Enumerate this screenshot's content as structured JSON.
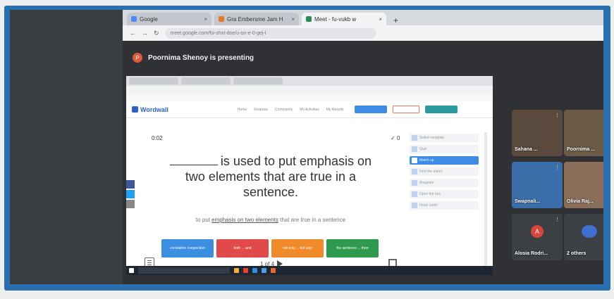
{
  "browser": {
    "tabs": [
      {
        "label": "Google",
        "color": "#4a8af4"
      },
      {
        "label": "Gra Embersme Jam H",
        "color": "#e8792a"
      },
      {
        "label": "Meet - fu-vukb w",
        "color": "#2d8a5a"
      }
    ],
    "url": "meet.google.com/fsi-shxt-doe/u-on-e-0-gej-l"
  },
  "meet": {
    "presenter_initial": "P",
    "presenting_text": "Poornima Shenoy is presenting",
    "participants": [
      {
        "name": "Sahana ...",
        "tile_color": "#5a4a3e"
      },
      {
        "name": "Poornima ...",
        "tile_color": "#6b5a45"
      },
      {
        "name": "Swapnali...",
        "tile_color": "#3a6ea8"
      },
      {
        "name": "Olivia Raj...",
        "tile_color": "#8a6e5a"
      },
      {
        "name": "Alosia Rodri...",
        "initial": "A",
        "avatar_color": "#d9453a"
      },
      {
        "name": "2 others"
      }
    ]
  },
  "wordwall": {
    "logo": "Wordwall",
    "nav": [
      "Home",
      "Features",
      "Community",
      "My Activities",
      "My Results"
    ],
    "timer": "0:02",
    "score": "0",
    "question_rest": "is used to put emphasis on two elements that are true in a sentence.",
    "hint_pre": "to put ",
    "hint_link": "emphasis on two elements",
    "hint_post": " that are true in a sentence",
    "answers": [
      {
        "label": "correlative conjunction",
        "color": "#3b8fe0"
      },
      {
        "label": "both ... and",
        "color": "#e04a4a"
      },
      {
        "label": "not only ... but also",
        "color": "#f08a2a"
      },
      {
        "label": "the sentence ... then",
        "color": "#2e9a4e"
      }
    ],
    "pager": "1 of 4",
    "panel_items": [
      "Switch template",
      "Quiz",
      "Match up",
      "Find the match",
      "Anagram",
      "Open the box",
      "Flash cards"
    ]
  }
}
